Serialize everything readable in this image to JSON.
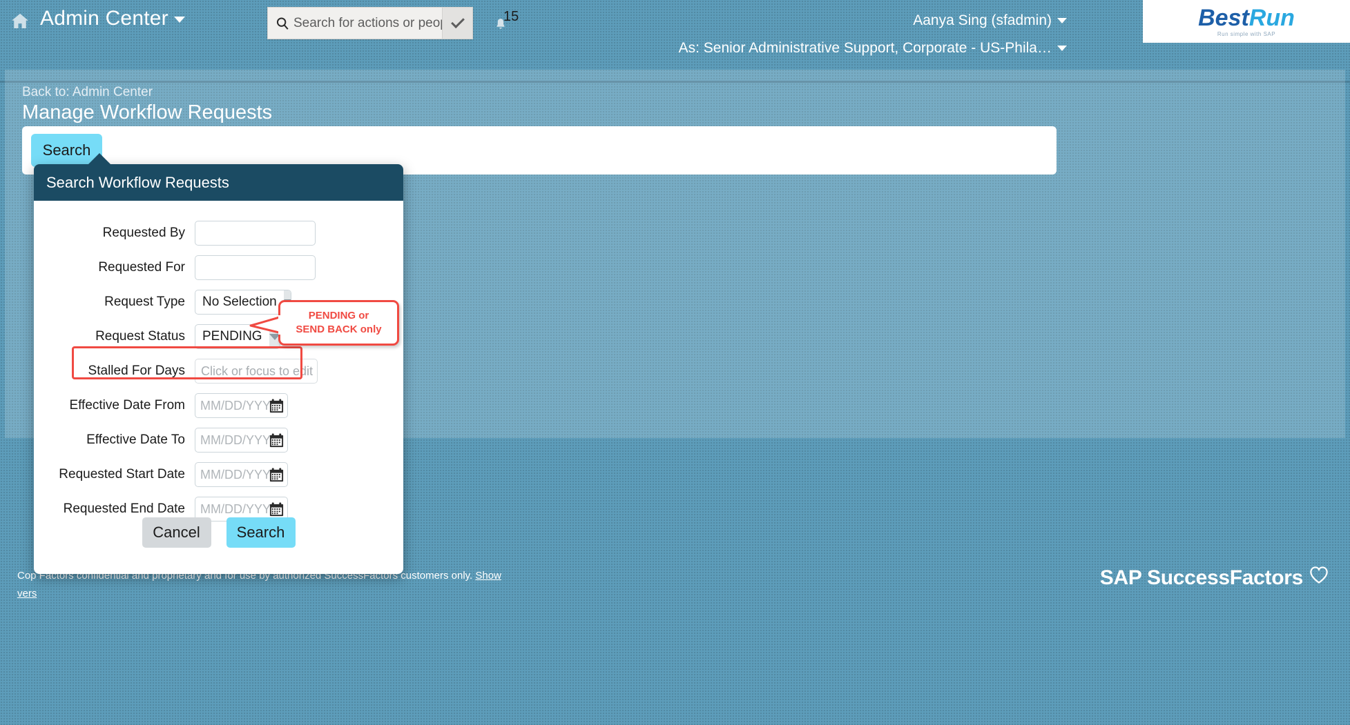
{
  "topbar": {
    "home_icon": "home-icon",
    "app_title": "Admin Center",
    "search": {
      "icon": "search-icon",
      "placeholder": "Search for actions or people",
      "dropdown_icon": "chevron-down-icon"
    },
    "notifications": {
      "icon": "bell-icon",
      "count": "15"
    },
    "user_name": "Aanya Sing (sfadmin)",
    "user_role": "As: Senior Administrative Support, Corporate - US-Phila…",
    "brand": {
      "best": "Best",
      "run": "Run",
      "tagline": "Run simple with SAP"
    }
  },
  "page": {
    "back_link": "Back to: Admin Center",
    "title": "Manage Workflow Requests",
    "search_tab": "Search"
  },
  "dialog": {
    "title": "Search Workflow Requests",
    "fields": [
      {
        "label": "Requested By",
        "type": "text",
        "value": "",
        "placeholder": ""
      },
      {
        "label": "Requested For",
        "type": "text",
        "value": "",
        "placeholder": ""
      },
      {
        "label": "Request Type",
        "type": "select",
        "value": "No Selection"
      },
      {
        "label": "Request Status",
        "type": "select",
        "value": "PENDING"
      },
      {
        "label": "Stalled For Days",
        "type": "stalled",
        "value": "",
        "placeholder": "Click or focus to edit"
      },
      {
        "label": "Effective Date From",
        "type": "date",
        "value": "",
        "placeholder": "MM/DD/YYYY"
      },
      {
        "label": "Effective Date To",
        "type": "date",
        "value": "",
        "placeholder": "MM/DD/YYYY"
      },
      {
        "label": "Requested Start Date",
        "type": "date",
        "value": "",
        "placeholder": "MM/DD/YYYY"
      },
      {
        "label": "Requested End Date",
        "type": "date",
        "value": "",
        "placeholder": "MM/DD/YYYY"
      }
    ],
    "cancel_label": "Cancel",
    "search_label": "Search"
  },
  "annotations": {
    "callout_text": "PENDING or SEND BACK only",
    "callout_line1": "PENDING or",
    "callout_line2": "SEND BACK only",
    "highlight_color": "#f04a42"
  },
  "footer": {
    "copyright_line": "Cop                                                                                          Factors confidential and proprietary and for use by authorized SuccessFactors customers only.",
    "show_link": "Show",
    "version_link": "vers",
    "copy_prefix": "Cop",
    "sf_logo_text": "SAP SuccessFactors",
    "heart_icon": "heart-icon"
  },
  "colors": {
    "page_bg": "#5d9dba",
    "dialog_header": "#1b4b63",
    "accent_cyan": "#76dcf7",
    "annotation_red": "#f04a42"
  }
}
